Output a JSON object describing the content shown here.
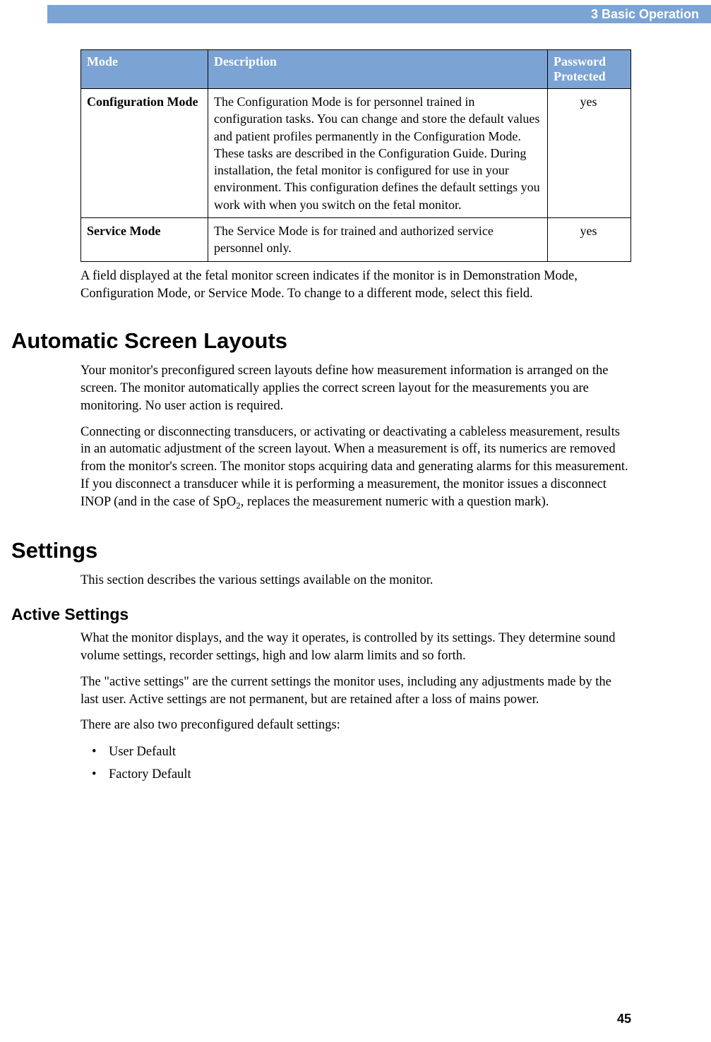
{
  "header": {
    "chapter": "3  Basic Operation"
  },
  "table": {
    "headers": {
      "mode": "Mode",
      "description": "Description",
      "password": "Password Protected"
    },
    "rows": [
      {
        "mode": "Configuration Mode",
        "description": "The Configuration Mode is for personnel trained in configuration tasks. You can change and store the default values and patient profiles permanently in the Configuration Mode. These tasks are described in the Configuration Guide. During installation, the fetal monitor is configured for use in your environment. This configuration defines the default settings you work with when you switch on the fetal monitor.",
        "password": "yes"
      },
      {
        "mode": "Service Mode",
        "description": "The Service Mode is for trained and authorized service personnel only.",
        "password": "yes"
      }
    ]
  },
  "after_table_para": "A field displayed at the fetal monitor screen indicates if the monitor is in Demonstration Mode, Configuration Mode, or Service Mode. To change to a different mode, select this field.",
  "sections": {
    "auto_layouts": {
      "title": "Automatic Screen Layouts",
      "p1": "Your monitor's preconfigured screen layouts define how measurement information is arranged on the screen. The monitor automatically applies the correct screen layout for the measurements you are monitoring. No user action is required.",
      "p2_pre": "Connecting or disconnecting transducers, or activating or deactivating a cableless measurement, results in an automatic adjustment of the screen layout. When a measurement is off, its numerics are removed from the monitor's screen. The monitor stops acquiring data and generating alarms for this measurement. If you disconnect a transducer while it is performing a measurement, the monitor issues a disconnect INOP (and in the case of SpO",
      "p2_sub": "2",
      "p2_post": ", replaces the measurement numeric with a question mark)."
    },
    "settings": {
      "title": "Settings",
      "intro": "This section describes the various settings available on the monitor."
    },
    "active_settings": {
      "title": "Active Settings",
      "p1": "What the monitor displays, and the way it operates, is controlled by its settings. They determine sound volume settings, recorder settings, high and low alarm limits and so forth.",
      "p2": "The \"active settings\" are the current settings the monitor uses, including any adjustments made by the last user. Active settings are not permanent, but are retained after a loss of mains power.",
      "p3": "There are also two preconfigured default settings:",
      "bullets": [
        "User Default",
        "Factory Default"
      ]
    }
  },
  "page_number": "45"
}
